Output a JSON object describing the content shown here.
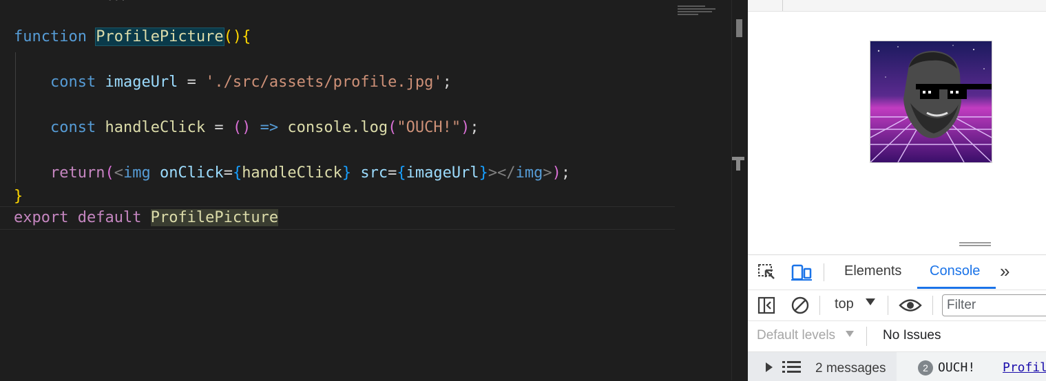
{
  "editor": {
    "top_fragment": "              ...",
    "lines": {
      "l1": {
        "kw": "function",
        "name": "ProfilePicture",
        "paren": "()",
        "brace": "{"
      },
      "l2": {
        "kw": "const",
        "var": "imageUrl",
        "eq": " = ",
        "str": "'./src/assets/profile.jpg'",
        "end": ";"
      },
      "l3": {
        "kw": "const",
        "var": "handleClick",
        "eq": " = ",
        "arrow_params": "()",
        "arrow": " => ",
        "call": "console.log",
        "open": "(",
        "str": "\"OUCH!\"",
        "close": ")",
        "end": ";"
      },
      "l4": {
        "kw": "return",
        "open": "(",
        "lt": "<",
        "tag": "img",
        "attr1": "onClick",
        "eq1": "=",
        "b1o": "{",
        "val1": "handleClick",
        "b1c": "}",
        "attr2": "src",
        "eq2": "=",
        "b2o": "{",
        "val2": "imageUrl",
        "b2c": "}",
        "gt": ">",
        "closetag_lt": "</",
        "closetag": "img",
        "closetag_gt": ">",
        "close": ")",
        "end": ";"
      },
      "l5": {
        "brace": "}"
      },
      "l6": {
        "kw1": "export",
        "kw2": "default",
        "name": "ProfilePicture"
      }
    }
  },
  "browser": {
    "image_alt": "profile",
    "image_description_icon": "profile-picture-meme-icon"
  },
  "devtools": {
    "tabs": [
      "Elements",
      "Console"
    ],
    "active_tab": "Console",
    "more_tabs_glyph": "»",
    "context": "top",
    "filter_placeholder": "Filter",
    "levels": "Default levels",
    "issues": "No Issues",
    "messages_label": "2 messages",
    "log_count": "2",
    "log_text": "OUCH!",
    "log_source": "Profil"
  },
  "colors": {
    "editor_bg": "#1e1e1e",
    "keyword": "#569cd6",
    "control_keyword": "#c586c0",
    "function": "#dcdcaa",
    "variable": "#9cdcfe",
    "string": "#ce9178",
    "accent": "#1a73e8"
  }
}
